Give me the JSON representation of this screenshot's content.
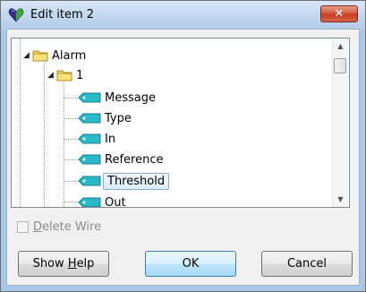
{
  "window": {
    "title": "Edit item 2",
    "close_label": "✕"
  },
  "tree": {
    "items": [
      {
        "label": "Alarm",
        "kind": "folder"
      },
      {
        "label": "1",
        "kind": "folder"
      },
      {
        "label": "Message",
        "kind": "tag"
      },
      {
        "label": "Type",
        "kind": "tag"
      },
      {
        "label": "In",
        "kind": "tag"
      },
      {
        "label": "Reference",
        "kind": "tag"
      },
      {
        "label": "Threshold",
        "kind": "tag",
        "selected": true
      },
      {
        "label": "Out",
        "kind": "tag"
      }
    ]
  },
  "options": {
    "delete_wire_label": "Delete Wire",
    "delete_wire_mnemonic": "D",
    "delete_wire_rest": "elete Wire",
    "delete_wire_checked": false,
    "delete_wire_enabled": false
  },
  "buttons": {
    "help_prefix": "Show ",
    "help_mnemonic": "H",
    "help_rest": "elp",
    "ok": "OK",
    "cancel": "Cancel"
  },
  "colors": {
    "tag_icon": "#29b9c9",
    "folder": "#f0d55a",
    "selection_border": "#84acdd",
    "close_button": "#c94a33"
  }
}
